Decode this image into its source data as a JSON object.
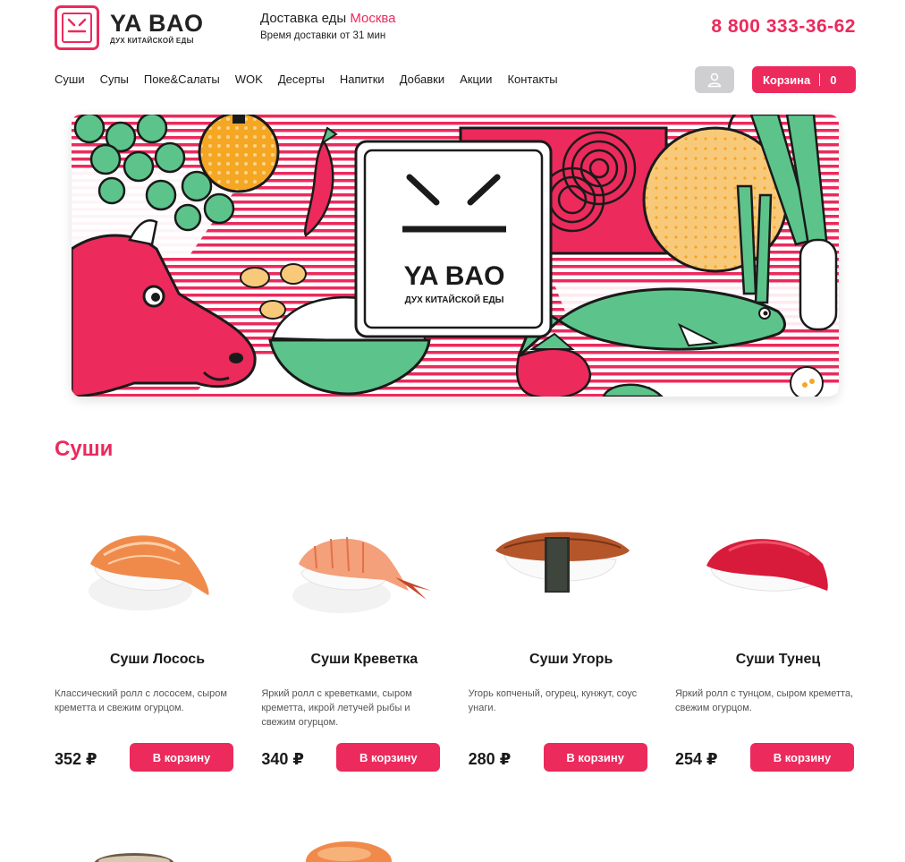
{
  "brand": {
    "name": "YA BAO",
    "tagline": "ДУХ КИТАЙСКОЙ ЕДЫ",
    "accent_color": "#ec2a5c"
  },
  "delivery": {
    "label": "Доставка еды",
    "city": "Москва",
    "time": "Время доставки от 31 мин"
  },
  "phone": "8 800 333-36-62",
  "nav": [
    "Суши",
    "Супы",
    "Поке&Салаты",
    "WOK",
    "Десерты",
    "Напитки",
    "Добавки",
    "Акции",
    "Контакты"
  ],
  "user_icon": "user-icon",
  "cart": {
    "label": "Корзина",
    "count": "0"
  },
  "banner": {
    "brand_name": "YA BAO",
    "brand_tagline": "ДУХ КИТАЙСКОЙ ЕДЫ"
  },
  "section": {
    "title": "Суши"
  },
  "products": [
    {
      "title": "Суши Лосось",
      "desc": "Классический ролл с лососем, сыром креметта и свежим огурцом.",
      "price": "352 ₽",
      "button": "В корзину",
      "topping_color": "#f08a4b"
    },
    {
      "title": "Суши Креветка",
      "desc": "Яркий ролл с креветками, сыром креметта, икрой летучей рыбы и свежим огурцом.",
      "price": "340 ₽",
      "button": "В корзину",
      "topping_color": "#f4a07a"
    },
    {
      "title": "Суши Угорь",
      "desc": "Угорь копченый, огурец, кунжут, соус унаги.",
      "price": "280 ₽",
      "button": "В корзину",
      "topping_color": "#b5562a"
    },
    {
      "title": "Суши Тунец",
      "desc": "Яркий ролл с тунцом, сыром креметта, свежим огурцом.",
      "price": "254 ₽",
      "button": "В корзину",
      "topping_color": "#d81b3a"
    }
  ]
}
